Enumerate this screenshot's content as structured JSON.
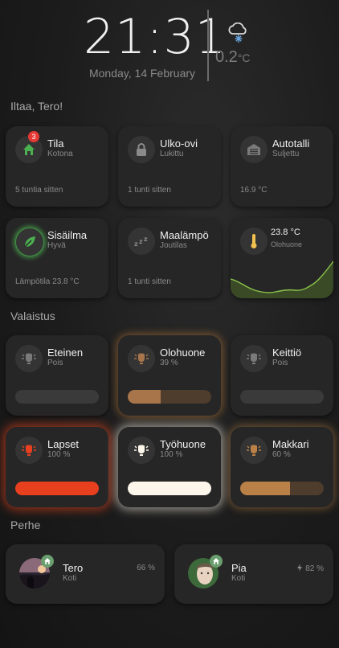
{
  "clock": {
    "time": "21:31",
    "date": "Monday, 14 February"
  },
  "weather": {
    "icon": "cloud-snow-icon",
    "temp": "0.2",
    "unit": "°C"
  },
  "greeting": "Iltaa, Tero!",
  "status_cards": [
    {
      "name": "Tila",
      "state": "Kotona",
      "foot": "5 tuntia sitten",
      "icon": "home-icon",
      "badge": "3"
    },
    {
      "name": "Ulko-ovi",
      "state": "Lukittu",
      "foot": "1 tunti sitten",
      "icon": "lock-icon"
    },
    {
      "name": "Autotalli",
      "state": "Suljettu",
      "foot": "16.9 °C",
      "icon": "garage-icon"
    },
    {
      "name": "Sisäilma",
      "state": "Hyvä",
      "foot": "Lämpötila 23.8 °C",
      "icon": "leaf-icon"
    },
    {
      "name": "Maalämpö",
      "state": "Joutilas",
      "foot": "1 tunti sitten",
      "icon": "sleep-icon"
    }
  ],
  "temp_card": {
    "value": "23.8 °C",
    "room": "Olohuone",
    "icon": "thermometer-icon"
  },
  "lighting_title": "Valaistus",
  "lights": [
    {
      "name": "Eteinen",
      "state": "Pois",
      "level": 0,
      "color": "#3a3a3a"
    },
    {
      "name": "Olohuone",
      "state": "39 %",
      "level": 0.39,
      "color": "#a8754a"
    },
    {
      "name": "Keittiö",
      "state": "Pois",
      "level": 0,
      "color": "#3a3a3a"
    },
    {
      "name": "Lapset",
      "state": "100 %",
      "level": 1.0,
      "color": "#e8401f"
    },
    {
      "name": "Työhuone",
      "state": "100 %",
      "level": 1.0,
      "color": "#fdf6ea"
    },
    {
      "name": "Makkari",
      "state": "60 %",
      "level": 0.6,
      "color": "#b98048"
    }
  ],
  "family_title": "Perhe",
  "family": [
    {
      "name": "Tero",
      "state": "Koti",
      "battery": "66 %"
    },
    {
      "name": "Pia",
      "state": "Koti",
      "battery": "82 %"
    }
  ]
}
